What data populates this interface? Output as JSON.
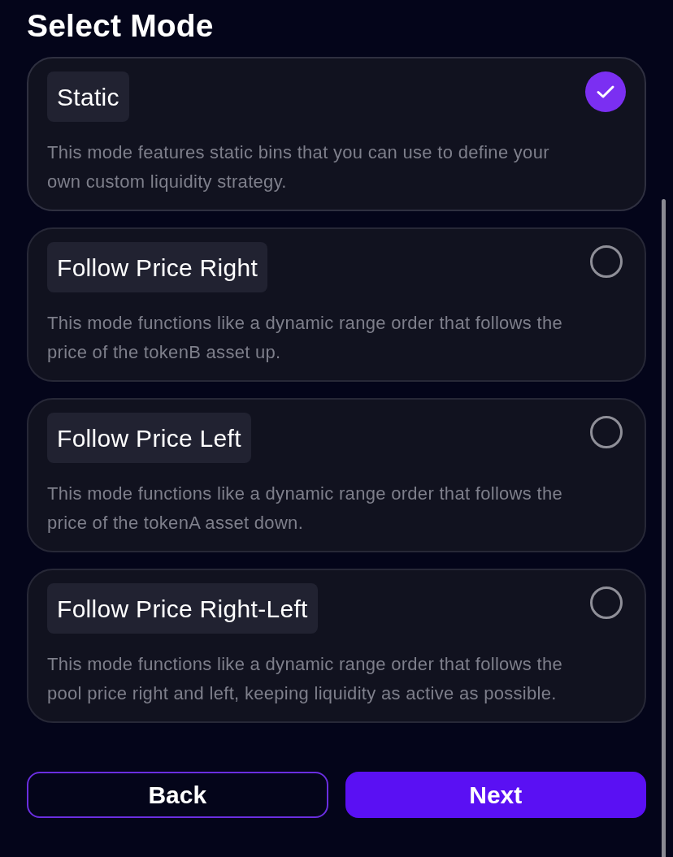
{
  "title": "Select Mode",
  "modes": [
    {
      "label": "Static",
      "description": "This mode features static bins that you can use to define your own custom liquidity strategy.",
      "selected": true
    },
    {
      "label": "Follow Price Right",
      "description": "This mode functions like a dynamic range order that follows the price of the tokenB asset up.",
      "selected": false
    },
    {
      "label": "Follow Price Left",
      "description": "This mode functions like a dynamic range order that follows the price of the tokenA asset down.",
      "selected": false
    },
    {
      "label": "Follow Price Right-Left",
      "description": "This mode functions like a dynamic range order that follows the pool price right and left, keeping liquidity as active as possible.",
      "selected": false
    }
  ],
  "buttons": [
    {
      "label": "Back",
      "kind": "outline"
    },
    {
      "label": "Next",
      "kind": "primary"
    }
  ]
}
